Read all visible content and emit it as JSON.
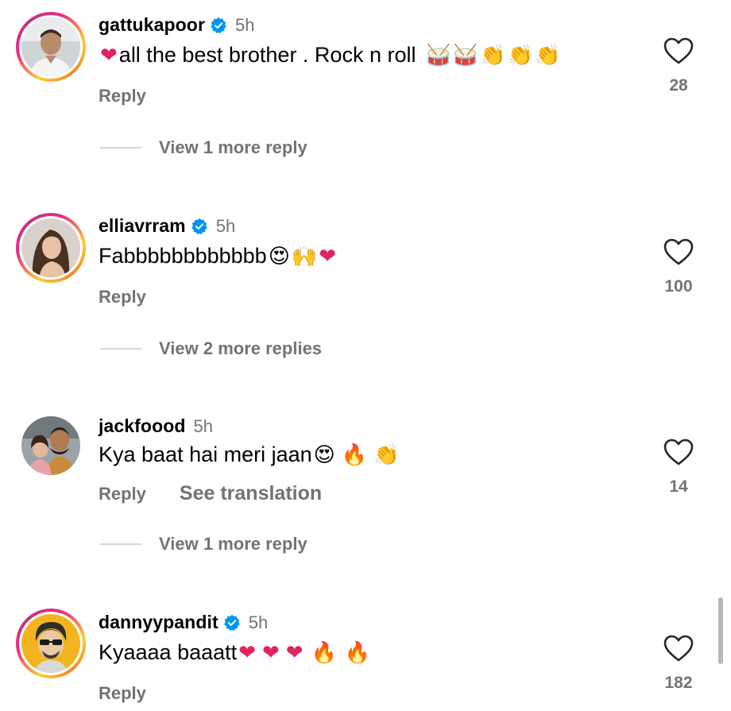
{
  "comments": [
    {
      "username": "gattukapoor",
      "verified": true,
      "time": "5h",
      "text": "all the best brother . Rock n roll",
      "reply_label": "Reply",
      "likes": "28",
      "view_more": "View 1 more reply"
    },
    {
      "username": "elliavrram",
      "verified": true,
      "time": "5h",
      "text": "Fabbbbbbbbbbbb",
      "reply_label": "Reply",
      "likes": "100",
      "view_more": "View 2 more replies"
    },
    {
      "username": "jackfoood",
      "verified": false,
      "time": "5h",
      "text": "Kya baat hai meri jaan",
      "reply_label": "Reply",
      "see_translation": "See translation",
      "likes": "14",
      "view_more": "View 1 more reply"
    },
    {
      "username": "dannyypandit",
      "verified": true,
      "time": "5h",
      "text": "Kyaaaa baaatt",
      "reply_label": "Reply",
      "likes": "182"
    }
  ],
  "colors": {
    "secondary_text": "#737373",
    "verified_blue": "#0095f6",
    "heart_red": "#e0245e"
  },
  "icons": [
    "verified-badge-icon",
    "heart-outline-icon",
    "red-heart-emoji",
    "drum-emoji",
    "clap-emoji",
    "heart-eyes-emoji",
    "raised-hands-emoji",
    "fire-emoji"
  ]
}
